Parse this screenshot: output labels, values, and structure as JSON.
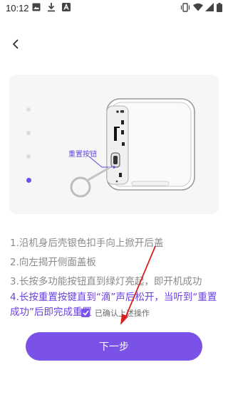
{
  "status_bar": {
    "time": "10:12",
    "left_icons": [
      "image-icon",
      "download-icon",
      "app-icon"
    ],
    "right_icons": [
      "vibrate-icon",
      "wifi-icon",
      "signal-icon",
      "battery-icon"
    ]
  },
  "nav": {
    "back_icon": "chevron-left-icon"
  },
  "illustration": {
    "callout_label": "重置按钮",
    "steps_total": 4,
    "active_step": 4
  },
  "instructions": [
    "1.沿机身后壳银色扣手向上掀开后盖",
    "2.向左揭开侧面盖板",
    "3.长按多功能按钮直到绿灯亮起，即开机成功",
    "4.长按重置按键直到“滴”声后松开，当听到“重置成功”后即完成重置"
  ],
  "confirm": {
    "label": "已确认上述操作",
    "checked": true
  },
  "next_button": {
    "label": "下一步"
  },
  "colors": {
    "accent": "#7b52e8",
    "active_text": "#6a3fe0",
    "muted_text": "#8a8a8a",
    "annotation": "#d92020"
  }
}
